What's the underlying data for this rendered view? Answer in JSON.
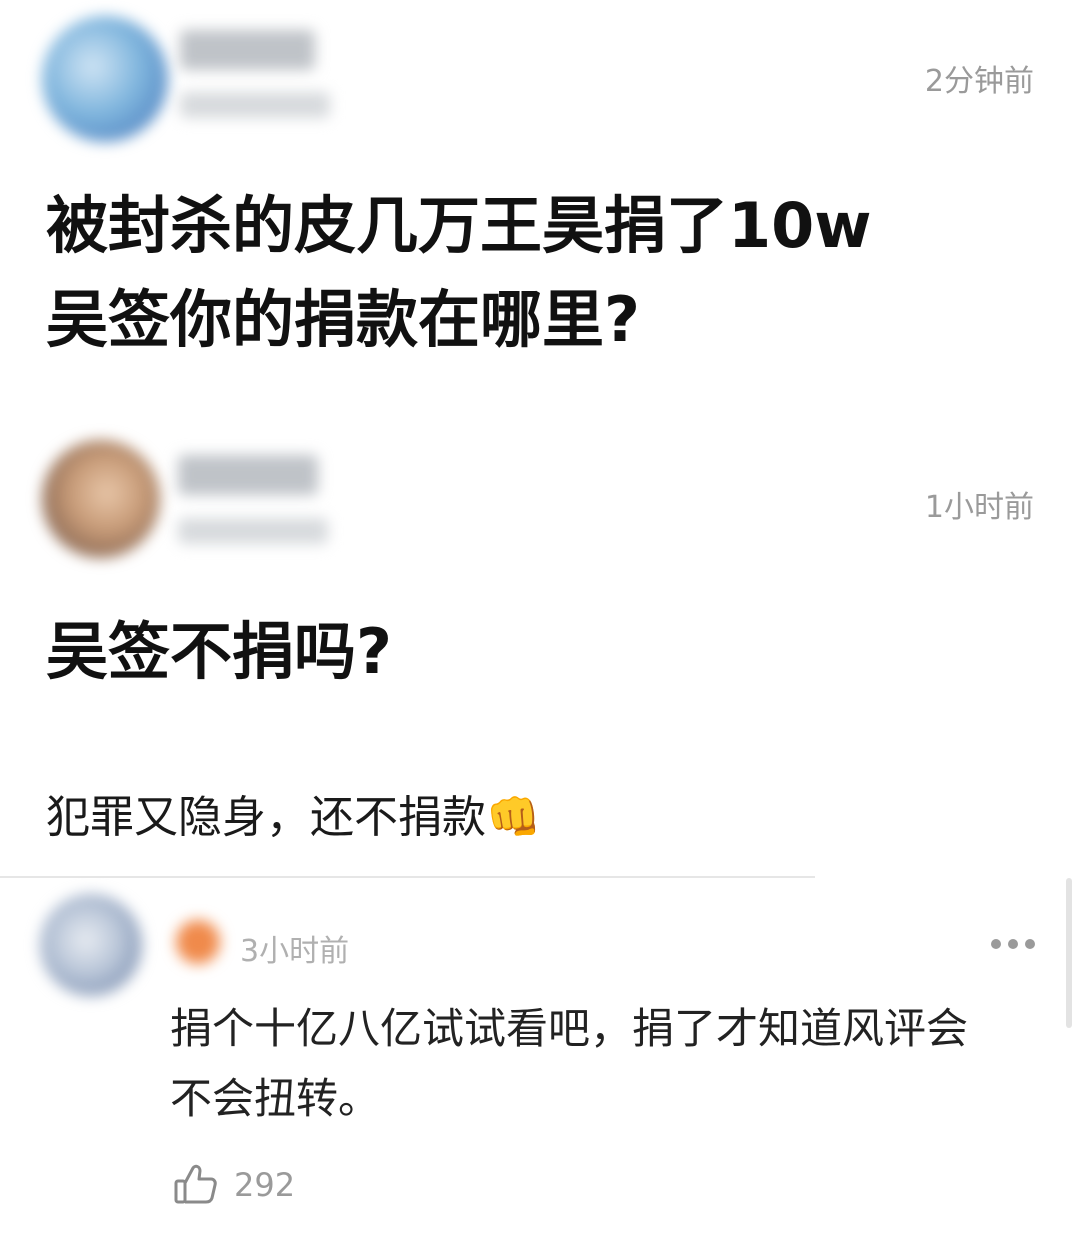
{
  "comments": [
    {
      "time": "2分钟前",
      "lines": [
        "被封杀的皮几万王昊捐了10w",
        "吴签你的捐款在哪里?"
      ]
    },
    {
      "time": "1小时前",
      "lines": [
        "吴签不捐吗?"
      ]
    }
  ],
  "caption": "犯罪又隐身，还不捐款",
  "caption_emoji": "👊",
  "reply": {
    "time": "3小时前",
    "lines": [
      "捐个十亿八亿试试看吧，捐了才知道风评会",
      "不会扭转。"
    ],
    "like_count": "292",
    "more_icon": "more-dots-icon",
    "like_icon": "thumbs-up-icon"
  }
}
